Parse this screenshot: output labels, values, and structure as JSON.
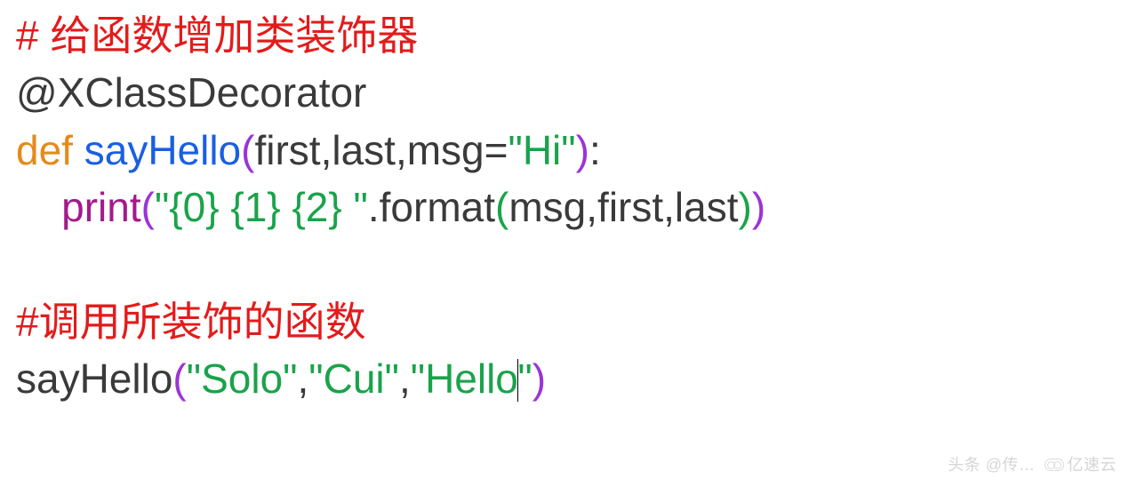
{
  "lines": {
    "l1": {
      "comment": "# 给函数增加类装饰器"
    },
    "l2": {
      "decorator": "@XClassDecorator"
    },
    "l3": {
      "kw_def": "def ",
      "fname": "sayHello",
      "lparen": "(",
      "params": "first,last,msg=",
      "default_str": "\"Hi\"",
      "rparen": ")",
      "colon": ":"
    },
    "l4": {
      "indent": "    ",
      "print": "print",
      "lparen": "(",
      "fmtstr": "\"{0} {1} {2} \"",
      "dot_format": ".format",
      "lparen2": "(",
      "args": "msg,first,last",
      "rparen2": ")",
      "rparen": ")"
    },
    "l5": {
      "blank": " "
    },
    "l6": {
      "comment": "#调用所装饰的函数"
    },
    "l7": {
      "fname": "sayHello",
      "lparen": "(",
      "arg1": "\"Solo\"",
      "comma1": ",",
      "arg2": "\"Cui\"",
      "comma2": ",",
      "arg3a": "\"Hello",
      "arg3b": "\"",
      "rparen": ")"
    }
  },
  "watermark": {
    "text1": "头条 @传…",
    "text2": "亿速云"
  }
}
